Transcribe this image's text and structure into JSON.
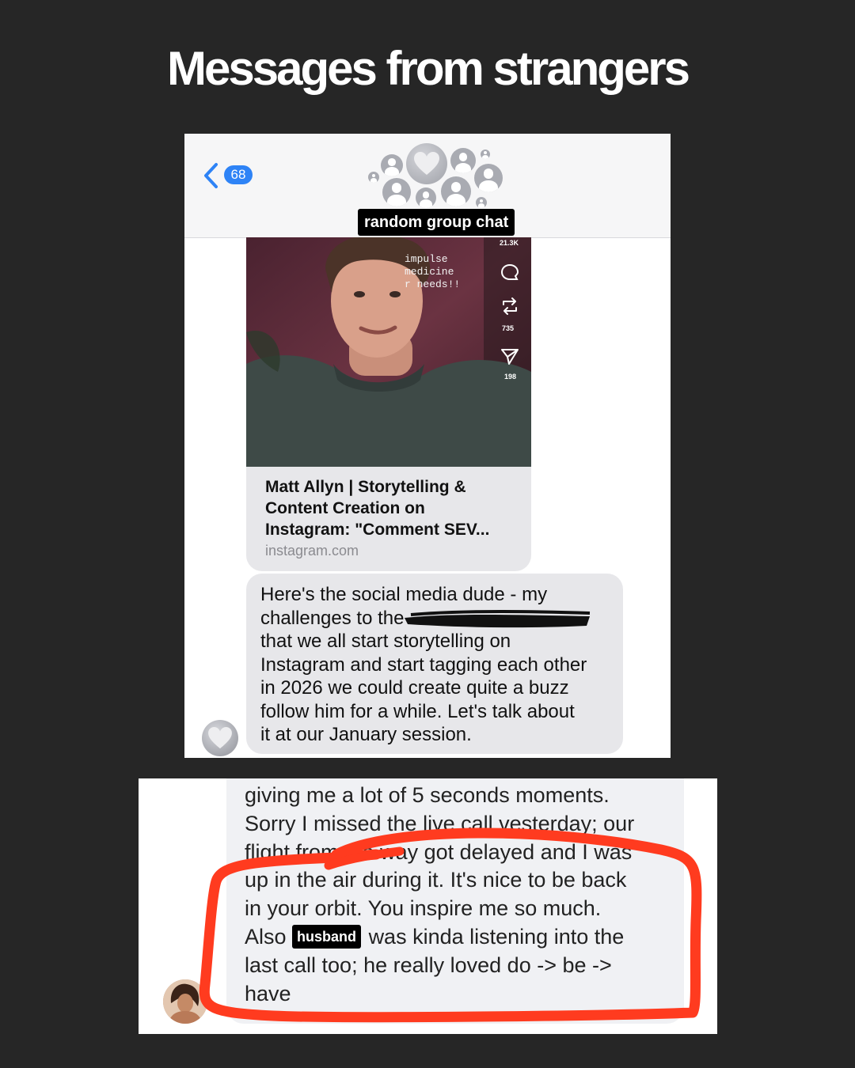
{
  "headline": "Messages from strangers",
  "chat1": {
    "unread_count": "68",
    "group_name_label": "random group chat",
    "video": {
      "caption": "impulse\nmedicine\nr needs!!",
      "stat_top": "21.3K",
      "stat_reposts": "735",
      "stat_shares": "198"
    },
    "link_preview": {
      "title": "Matt Allyn | Storytelling & Content Creation on Instagram: \"Comment SEV...",
      "domain": "instagram.com"
    },
    "message": {
      "line1": "Here's the social media dude - my",
      "line2": "challenges to the",
      "line3": "that we all start storytelling on",
      "line4": "Instagram and start tagging each other",
      "line5": "in 2026 we could create quite a buzz",
      "line6": "follow him for a while. Let's talk about",
      "line7": "it at our January session."
    }
  },
  "chat2": {
    "message": {
      "line1": "giving me a lot of 5 seconds moments.",
      "line2": "Sorry I missed the live call vesterday; our",
      "line3": "flight from the way got delayed and I was",
      "line4": "up in the air during it. It's nice to be back",
      "line5": "in your orbit. You inspire me so much.",
      "line6_prefix": "Also",
      "line6_tag": "husband",
      "line6_suffix": "was kinda listening into the",
      "line7": "last call too; he really loved do -> be ->",
      "line8": "have"
    }
  },
  "colors": {
    "background": "#262626",
    "imessage_blue": "#2e83f6",
    "received_bubble": "#e7e7ea",
    "annotation_red": "#ff3b1f"
  },
  "icons": [
    "back-chevron-icon",
    "heart-icon",
    "comment-icon",
    "repost-icon",
    "share-icon",
    "person-icon"
  ]
}
